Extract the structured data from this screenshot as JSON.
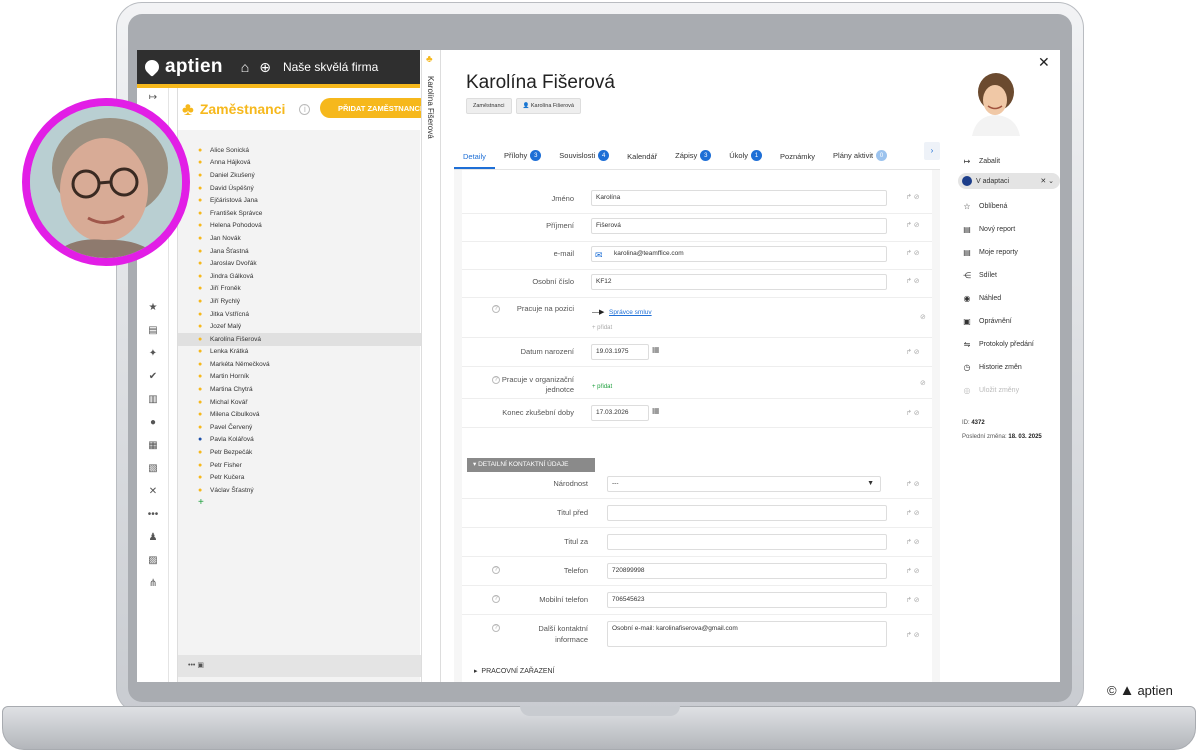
{
  "app": {
    "logo": "aptien",
    "company": "Naše skvělá firma"
  },
  "panel": {
    "title": "Zaměstnanci",
    "add_button": "PŘIDAT ZAMĚSTNANCE",
    "footer": "•••"
  },
  "employees": [
    {
      "name": "Alice Sonická",
      "gender": "f"
    },
    {
      "name": "Anna Hájková",
      "gender": "f"
    },
    {
      "name": "Daniel Zkušený",
      "gender": "f"
    },
    {
      "name": "David Úspěšný",
      "gender": "f"
    },
    {
      "name": "Ejčáristová Jana",
      "gender": "f"
    },
    {
      "name": "František Správce",
      "gender": "f"
    },
    {
      "name": "Helena Pohodová",
      "gender": "f"
    },
    {
      "name": "Jan Novák",
      "gender": "f"
    },
    {
      "name": "Jana Šťastná",
      "gender": "f"
    },
    {
      "name": "Jaroslav Dvořák",
      "gender": "f"
    },
    {
      "name": "Jindra Gálková",
      "gender": "f"
    },
    {
      "name": "Jiří Froněk",
      "gender": "f"
    },
    {
      "name": "Jiří Rychlý",
      "gender": "f"
    },
    {
      "name": "Jitka Vstřícná",
      "gender": "f"
    },
    {
      "name": "Jozef Malý",
      "gender": "f"
    },
    {
      "name": "Karolína Fišerová",
      "gender": "f",
      "selected": true
    },
    {
      "name": "Lenka Krátká",
      "gender": "f"
    },
    {
      "name": "Markéta Němečková",
      "gender": "f"
    },
    {
      "name": "Martin Horník",
      "gender": "f"
    },
    {
      "name": "Martina Chytrá",
      "gender": "f"
    },
    {
      "name": "Michal Kovář",
      "gender": "f"
    },
    {
      "name": "Milena Cibulková",
      "gender": "f"
    },
    {
      "name": "Pavel Červený",
      "gender": "f"
    },
    {
      "name": "Pavla Kolářová",
      "gender": "m"
    },
    {
      "name": "Petr Bezpečák",
      "gender": "f"
    },
    {
      "name": "Petr Fisher",
      "gender": "f"
    },
    {
      "name": "Petr Kučera",
      "gender": "f"
    },
    {
      "name": "Václav Šťastný",
      "gender": "f"
    }
  ],
  "vtab": {
    "text": "Karolína Fišerová"
  },
  "detail": {
    "name": "Karolína Fišerová",
    "crumb1": "Zaměstnanci",
    "crumb2": "Karolína Fišerová",
    "tabs": [
      {
        "label": "Detaily",
        "badge": null
      },
      {
        "label": "Přílohy",
        "badge": "3"
      },
      {
        "label": "Souvislosti",
        "badge": "4"
      },
      {
        "label": "Kalendář",
        "badge": null
      },
      {
        "label": "Zápisy",
        "badge": "3"
      },
      {
        "label": "Úkoly",
        "badge": "1"
      },
      {
        "label": "Poznámky",
        "badge": null
      },
      {
        "label": "Plány aktivit",
        "badge": "0"
      }
    ],
    "fields": {
      "jmeno_label": "Jméno",
      "jmeno": "Karolína",
      "prijmeni_label": "Příjmení",
      "prijmeni": "Fišerová",
      "email_label": "e-mail",
      "email": "karolina@teamffice.com",
      "oscislo_label": "Osobní číslo",
      "oscislo": "KF12",
      "pozice_label": "Pracuje na pozici",
      "pozice": "Správce smluv",
      "pozice_add": "+ přidat",
      "narozeni_label": "Datum narození",
      "narozeni": "19.03.1975",
      "org_label1": "Pracuje v organizační",
      "org_label2": "jednotce",
      "org_add": "+ přidat",
      "zkusebni_label": "Konec zkušební doby",
      "zkusebni": "17.03.2026"
    },
    "section": "DETAILNÍ KONTAKTNÍ ÚDAJE",
    "contact": {
      "narodnost_label": "Národnost",
      "narodnost": "---",
      "titul_pred_label": "Titul před",
      "titul_pred": "",
      "titul_za_label": "Titul za",
      "titul_za": "",
      "telefon_label": "Telefon",
      "telefon": "720899998",
      "mobil_label": "Mobilní telefon",
      "mobil": "706545623",
      "dalsi_label1": "Další kontaktní",
      "dalsi_label2": "informace",
      "dalsi": "Osobní e-mail: karolinafiserova@gmail.com"
    },
    "section_foot": "PRACOVNÍ ZAŘAZENÍ"
  },
  "actions": {
    "zabalit": "Zabalit",
    "status": "V adaptaci",
    "oblibena": "Oblíbená",
    "novy_report": "Nový report",
    "moje_reporty": "Moje reporty",
    "sdilet": "Sdílet",
    "nahled": "Náhled",
    "opravneni": "Oprávnění",
    "protokoly": "Protokoly předání",
    "historie": "Historie změn",
    "ulozit": "Uložit změny",
    "id_label": "ID:",
    "id": "4372",
    "zmena_label": "Poslední změna:",
    "zmena": "18. 03. 2025"
  },
  "copyright": {
    "symbol": "©",
    "brand": "aptien"
  }
}
